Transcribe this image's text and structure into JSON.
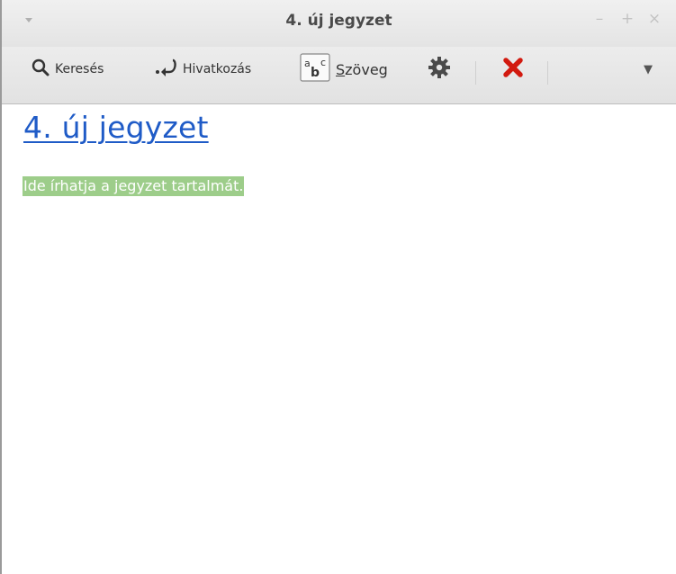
{
  "window": {
    "title": "4. új jegyzet",
    "controls": {
      "minimize": "–",
      "maximize": "+",
      "close": "×"
    }
  },
  "toolbar": {
    "search_label": "Keresés",
    "link_label": "Hivatkozás",
    "text_label_first": "S",
    "text_label_rest": "zöveg",
    "menu_arrow": "▼"
  },
  "note": {
    "title": "4. új jegyzet",
    "body": "Ide írhatja a jegyzet tartalmát."
  },
  "colors": {
    "title_link": "#1f5bc7",
    "selection_highlight": "#9dcd8a",
    "delete_icon": "#d21a0f"
  }
}
